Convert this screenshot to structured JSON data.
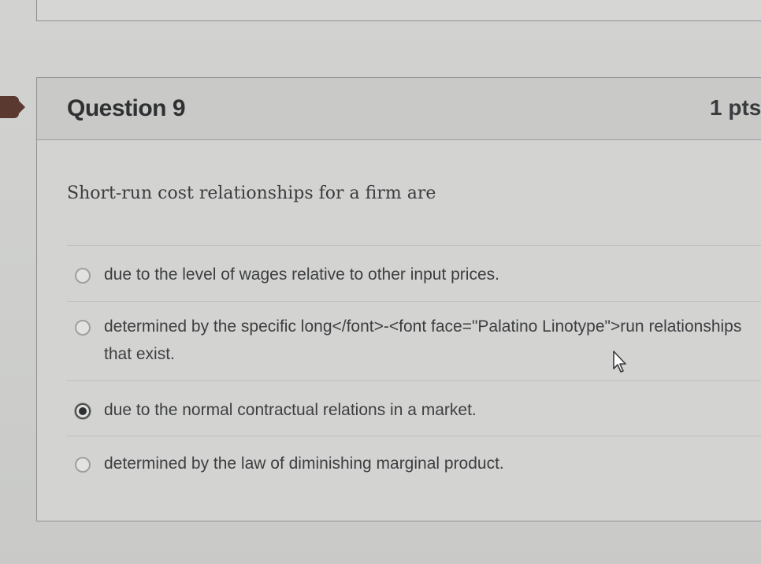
{
  "question": {
    "title": "Question 9",
    "points": "1 pts",
    "text": "Short-run cost relationships for a firm are"
  },
  "answers": [
    {
      "label": "due to the level of wages relative to other input prices.",
      "selected": false
    },
    {
      "label": "determined by the specific long</font>-<font face=\"Palatino Linotype\">run relationships that exist.",
      "selected": false
    },
    {
      "label": "due to the normal contractual relations in a market.",
      "selected": true
    },
    {
      "label": "determined by the law of diminishing marginal product.",
      "selected": false
    }
  ],
  "icons": {
    "radio": "radio-button-icon",
    "cursor": "mouse-pointer-icon",
    "marker": "question-flag-icon"
  },
  "colors": {
    "background": "#d2d3d1",
    "header": "#c9cac8",
    "flag": "#5a3a30"
  }
}
